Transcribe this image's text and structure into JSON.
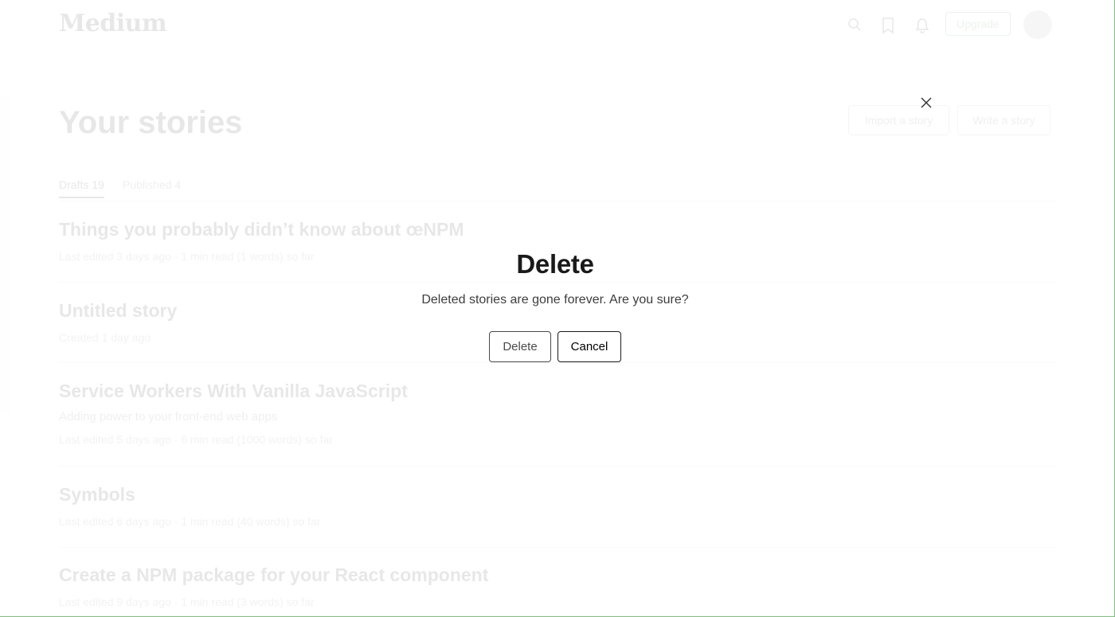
{
  "header": {
    "logo": "Medium",
    "upgrade_label": "Upgrade",
    "icons": [
      "search-icon",
      "bookmark-icon",
      "bell-icon"
    ]
  },
  "page": {
    "title": "Your stories",
    "import_label": "Import a story",
    "write_label": "Write a story",
    "tabs": [
      {
        "label": "Drafts 19"
      },
      {
        "label": "Published 4"
      }
    ],
    "stories": [
      {
        "title": "Things you probably didn’t know about œNPM",
        "subtitle": "",
        "meta": "Last edited 3 days ago · 1 min read (1 words) so far"
      },
      {
        "title": "Untitled story",
        "subtitle": "",
        "meta": "Created 1 day ago"
      },
      {
        "title": "Service Workers With Vanilla JavaScript",
        "subtitle": "Adding power to your front-end web apps",
        "meta": "Last edited 5 days ago · 6 min read (1000 words) so far"
      },
      {
        "title": "Symbols",
        "subtitle": "",
        "meta": "Last edited 6 days ago · 1 min read (40 words) so far"
      },
      {
        "title": "Create a NPM package for your React component",
        "subtitle": "",
        "meta": "Last edited 9 days ago · 1 min read (3 words) so far"
      }
    ]
  },
  "dialog": {
    "title": "Delete",
    "body": "Deleted stories are gone forever. Are you sure?",
    "delete_label": "Delete",
    "cancel_label": "Cancel"
  }
}
